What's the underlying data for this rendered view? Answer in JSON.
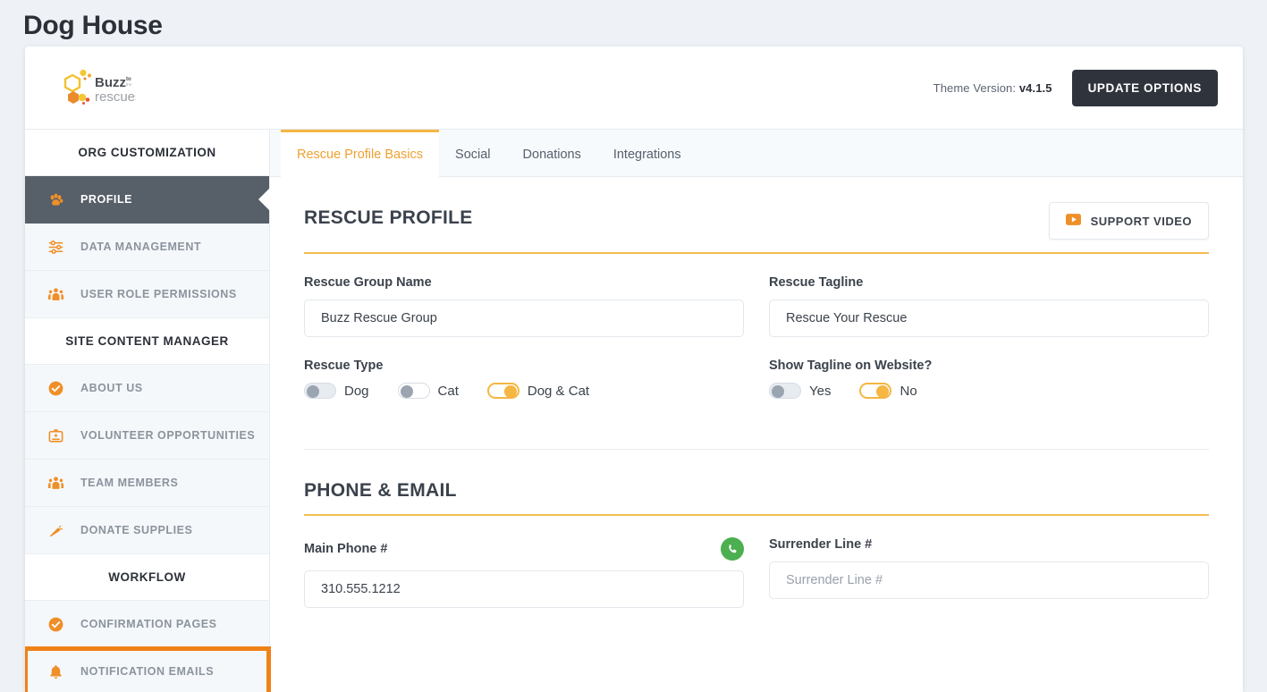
{
  "page": {
    "title": "Dog House"
  },
  "topbar": {
    "logo_alt": "Buzz to the rescues",
    "logo_word1": "Buzz",
    "logo_word2": "to",
    "logo_word3": "the",
    "logo_word4": "rescues",
    "theme_version_label": "Theme Version:",
    "theme_version_value": "v4.1.5",
    "update_button": "UPDATE OPTIONS"
  },
  "sidebar": {
    "groups": [
      {
        "header": "ORG CUSTOMIZATION",
        "items": [
          {
            "label": "PROFILE",
            "icon": "paw-icon",
            "active": true,
            "highlighted": false
          },
          {
            "label": "DATA MANAGEMENT",
            "icon": "sliders-icon",
            "active": false,
            "highlighted": false
          },
          {
            "label": "USER ROLE PERMISSIONS",
            "icon": "users-icon",
            "active": false,
            "highlighted": false
          }
        ]
      },
      {
        "header": "SITE CONTENT MANAGER",
        "items": [
          {
            "label": "ABOUT US",
            "icon": "check-circle-icon",
            "active": false,
            "highlighted": false
          },
          {
            "label": "VOLUNTEER OPPORTUNITIES",
            "icon": "id-badge-icon",
            "active": false,
            "highlighted": false
          },
          {
            "label": "TEAM MEMBERS",
            "icon": "users-icon",
            "active": false,
            "highlighted": false
          },
          {
            "label": "DONATE SUPPLIES",
            "icon": "carrot-icon",
            "active": false,
            "highlighted": false
          }
        ]
      },
      {
        "header": "WORKFLOW",
        "items": [
          {
            "label": "CONFIRMATION PAGES",
            "icon": "check-circle-icon",
            "active": false,
            "highlighted": false
          },
          {
            "label": "NOTIFICATION EMAILS",
            "icon": "bell-icon",
            "active": false,
            "highlighted": true
          }
        ]
      }
    ]
  },
  "tabs": [
    {
      "label": "Rescue Profile Basics",
      "active": true
    },
    {
      "label": "Social",
      "active": false
    },
    {
      "label": "Donations",
      "active": false
    },
    {
      "label": "Integrations",
      "active": false
    }
  ],
  "sections": [
    {
      "title": "RESCUE PROFILE",
      "support_button": {
        "label": "SUPPORT VIDEO",
        "icon": "video-play-icon"
      },
      "fields": {
        "group_name_label": "Rescue Group Name",
        "group_name_value": "Buzz Rescue Group",
        "group_name_placeholder": "Rescue Group Name",
        "tagline_label": "Rescue Tagline",
        "tagline_value": "Rescue Your Rescue",
        "tagline_placeholder": "Rescue Tagline",
        "rescue_type_label": "Rescue Type",
        "rescue_type_options": [
          {
            "label": "Dog",
            "on": false,
            "style": "filled"
          },
          {
            "label": "Cat",
            "on": false,
            "style": "plain"
          },
          {
            "label": "Dog & Cat",
            "on": true,
            "style": "on"
          }
        ],
        "show_tagline_label": "Show Tagline on Website?",
        "show_tagline_options": [
          {
            "label": "Yes",
            "on": false,
            "style": "filled"
          },
          {
            "label": "No",
            "on": true,
            "style": "on"
          }
        ]
      }
    },
    {
      "title": "PHONE & EMAIL",
      "fields": {
        "main_phone_label": "Main Phone #",
        "main_phone_value": "310.555.1212",
        "main_phone_placeholder": "Main Phone #",
        "main_phone_status_icon": "phone-valid-icon",
        "surrender_label": "Surrender Line #",
        "surrender_value": "",
        "surrender_placeholder": "Surrender Line #"
      }
    }
  ],
  "colors": {
    "accent_orange": "#ef8217",
    "accent_yellow": "#f5b642",
    "tab_active_text": "#f0a030",
    "dark": "#2f343c",
    "sidebar_active_bg": "#575f68",
    "valid_green": "#4caf50"
  }
}
